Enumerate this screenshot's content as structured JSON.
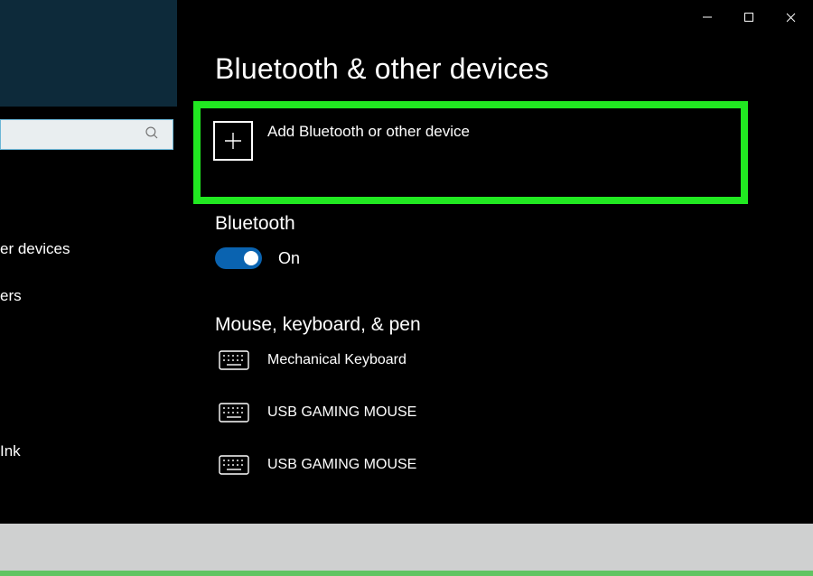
{
  "titlebar": {
    "min": "minimize",
    "max": "maximize",
    "close": "close"
  },
  "sidebar": {
    "search_placeholder": "",
    "items": [
      "er devices",
      "ers",
      "Ink"
    ]
  },
  "page": {
    "title": "Bluetooth & other devices"
  },
  "add_device": {
    "label": "Add Bluetooth or other device"
  },
  "bluetooth": {
    "heading": "Bluetooth",
    "state_label": "On",
    "enabled": true
  },
  "mkp": {
    "heading": "Mouse, keyboard, & pen",
    "devices": [
      {
        "name": "Mechanical Keyboard",
        "icon": "keyboard"
      },
      {
        "name": "USB GAMING MOUSE",
        "icon": "keyboard"
      },
      {
        "name": "USB GAMING MOUSE",
        "icon": "keyboard"
      }
    ]
  }
}
